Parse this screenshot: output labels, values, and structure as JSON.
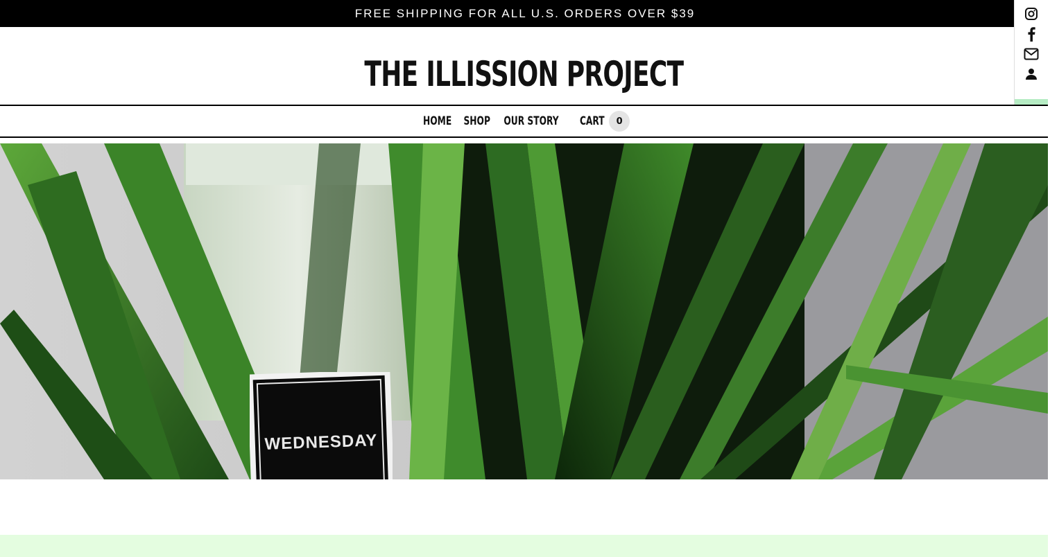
{
  "announcement": "FREE SHIPPING FOR ALL U.S. ORDERS OVER $39",
  "brand": "THE ILLISSION PROJECT",
  "nav": {
    "home": "HOME",
    "shop": "SHOP",
    "story": "OUR STORY",
    "cart": "CART",
    "cart_count": "0"
  },
  "social": [
    "instagram-icon",
    "facebook-icon",
    "mail-icon",
    "user-icon"
  ],
  "hero": {
    "label_text": "WEDNESDAY"
  },
  "colors": {
    "announce_bg": "#000000",
    "band_green": "#e4fde0",
    "strip_green": "#b6ecc4"
  }
}
